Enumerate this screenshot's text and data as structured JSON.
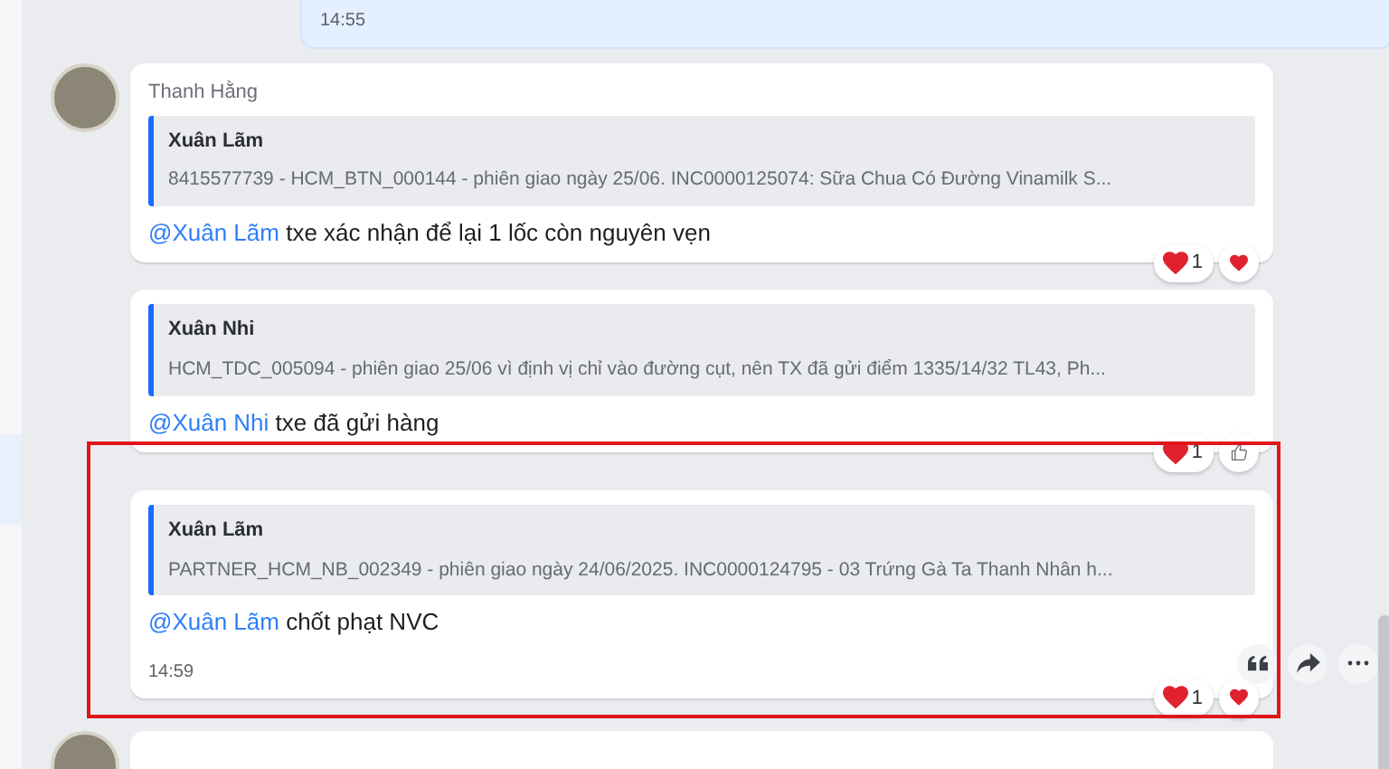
{
  "own_message": {
    "time": "14:55"
  },
  "messages": [
    {
      "sender": "Thanh Hằng",
      "show_avatar": true,
      "quote": {
        "author": "Xuân Lãm",
        "text": "8415577739 - HCM_BTN_000144 - phiên giao ngày 25/06. INC0000125074: Sữa Chua Có Đường Vinamilk S..."
      },
      "mention": "@Xuân Lãm",
      "text": "txe xác nhận để lại 1 lốc còn nguyên vẹn",
      "reactions": {
        "count": "1",
        "quick_reaction": {
          "kind": "heart"
        }
      },
      "highlighted": false,
      "hovered": false
    },
    {
      "show_avatar": false,
      "quote": {
        "author": "Xuân Nhi",
        "text": "HCM_TDC_005094 - phiên giao 25/06 vì định vị chỉ vào đường cụt, nên TX đã gửi điểm 1335/14/32 TL43, Ph..."
      },
      "mention": "@Xuân Nhi",
      "text": "txe đã gửi hàng",
      "reactions": {
        "count": "1",
        "quick_reaction": {
          "kind": "like"
        }
      },
      "highlighted": false,
      "hovered": false
    },
    {
      "show_avatar": false,
      "quote": {
        "author": "Xuân Lãm",
        "text": "PARTNER_HCM_NB_002349 - phiên giao ngày 24/06/2025. INC0000124795 - 03 Trứng Gà Ta Thanh Nhân h..."
      },
      "mention": "@Xuân Lãm",
      "text": "chốt phạt NVC",
      "time": "14:59",
      "reactions": {
        "count": "1",
        "quick_reaction": {
          "kind": "heart"
        }
      },
      "highlighted": true,
      "hovered": true
    }
  ],
  "next_message": {
    "show_avatar": true
  }
}
